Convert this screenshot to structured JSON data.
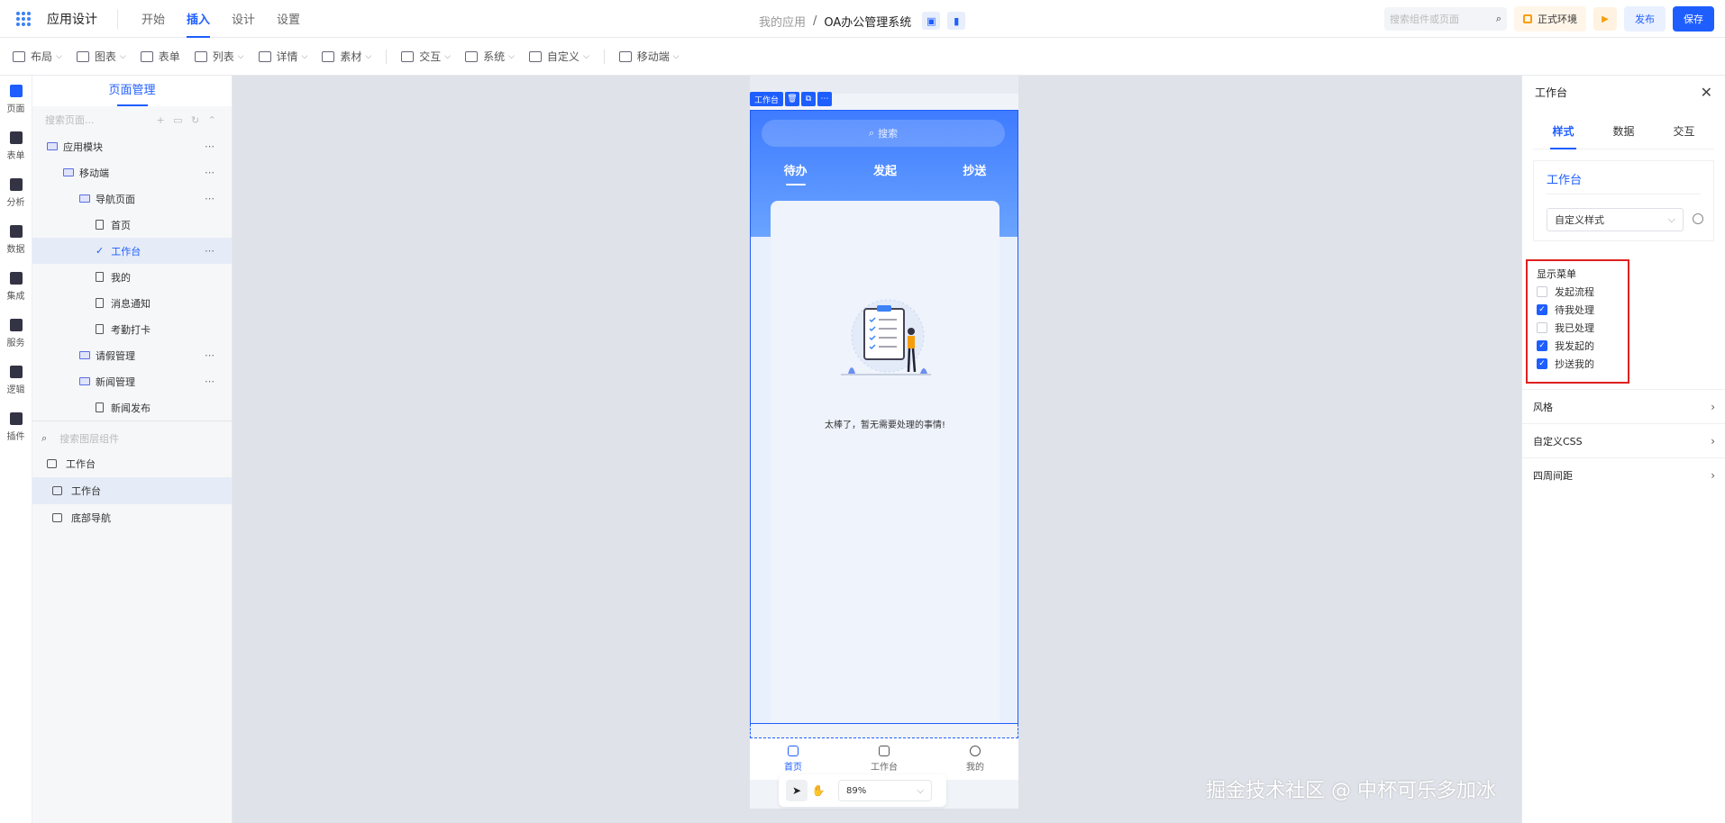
{
  "header": {
    "app_title": "应用设计",
    "tabs": [
      {
        "label": "开始"
      },
      {
        "label": "插入",
        "active": true
      },
      {
        "label": "设计"
      },
      {
        "label": "设置"
      }
    ],
    "breadcrumb_parent": "我的应用",
    "breadcrumb_sep": "/",
    "breadcrumb_current": "OA办公管理系统",
    "search_placeholder": "搜索组件或页面",
    "env_label": "正式环境",
    "publish_label": "发布",
    "save_label": "保存",
    "accent_color": "#1e5eff"
  },
  "toolbar": {
    "items": [
      {
        "label": "布局",
        "icon": "layout-icon"
      },
      {
        "label": "图表",
        "icon": "chart-icon"
      },
      {
        "label": "表单",
        "icon": "form-icon"
      },
      {
        "label": "列表",
        "icon": "list-icon"
      },
      {
        "label": "详情",
        "icon": "detail-icon"
      },
      {
        "label": "素材",
        "icon": "image-icon"
      },
      {
        "label": "交互",
        "icon": "interaction-icon"
      },
      {
        "label": "系统",
        "icon": "system-icon"
      },
      {
        "label": "自定义",
        "icon": "custom-icon"
      },
      {
        "label": "移动端",
        "icon": "mobile-icon"
      }
    ]
  },
  "rail": {
    "items": [
      {
        "label": "页面",
        "active": true
      },
      {
        "label": "表单"
      },
      {
        "label": "分析"
      },
      {
        "label": "数据"
      },
      {
        "label": "集成"
      },
      {
        "label": "服务"
      },
      {
        "label": "逻辑"
      },
      {
        "label": "插件"
      }
    ]
  },
  "tree": {
    "title": "页面管理",
    "search_placeholder": "搜索页面...",
    "rows": [
      {
        "label": "应用模块",
        "type": "folder",
        "indent": 0,
        "more": true
      },
      {
        "label": "移动端",
        "type": "folder",
        "indent": 1,
        "more": true
      },
      {
        "label": "导航页面",
        "type": "folder",
        "indent": 2,
        "more": true
      },
      {
        "label": "首页",
        "type": "doc",
        "indent": 3
      },
      {
        "label": "工作台",
        "type": "check",
        "indent": 3,
        "more": true,
        "selected": true
      },
      {
        "label": "我的",
        "type": "doc",
        "indent": 3
      },
      {
        "label": "消息通知",
        "type": "doc",
        "indent": 3
      },
      {
        "label": "考勤打卡",
        "type": "doc",
        "indent": 3
      },
      {
        "label": "请假管理",
        "type": "folder",
        "indent": 2,
        "more": true
      },
      {
        "label": "新闻管理",
        "type": "folder",
        "indent": 2,
        "more": true
      },
      {
        "label": "新闻发布",
        "type": "doc",
        "indent": 3
      }
    ],
    "layer_search_placeholder": "搜索图层组件",
    "layers": [
      {
        "label": "工作台",
        "indent": 0
      },
      {
        "label": "工作台",
        "indent": 1,
        "selected": true
      },
      {
        "label": "底部导航",
        "indent": 1
      }
    ]
  },
  "canvas": {
    "selected_tag": "工作台",
    "search_placeholder": "搜索",
    "tabs": [
      {
        "label": "待办",
        "active": true
      },
      {
        "label": "发起"
      },
      {
        "label": "抄送"
      }
    ],
    "empty_text": "太棒了，暂无需要处理的事情!",
    "bottom_nav": [
      {
        "label": "首页",
        "active": true,
        "icon": "home-icon"
      },
      {
        "label": "工作台",
        "icon": "workbench-icon"
      },
      {
        "label": "我的",
        "icon": "user-icon"
      }
    ],
    "zoom": "89%",
    "watermark": "掘金技术社区 @ 中杯可乐多加冰"
  },
  "props": {
    "title": "工作台",
    "tabs": [
      {
        "label": "样式",
        "active": true
      },
      {
        "label": "数据"
      },
      {
        "label": "交互"
      }
    ],
    "component_name": "工作台",
    "style_select": "自定义样式",
    "menu_title": "显示菜单",
    "menu_options": [
      {
        "label": "发起流程",
        "checked": false
      },
      {
        "label": "待我处理",
        "checked": true
      },
      {
        "label": "我已处理",
        "checked": false
      },
      {
        "label": "我发起的",
        "checked": true
      },
      {
        "label": "抄送我的",
        "checked": true
      }
    ],
    "sections": [
      {
        "label": "风格"
      },
      {
        "label": "自定义CSS"
      },
      {
        "label": "四周间距"
      }
    ]
  }
}
